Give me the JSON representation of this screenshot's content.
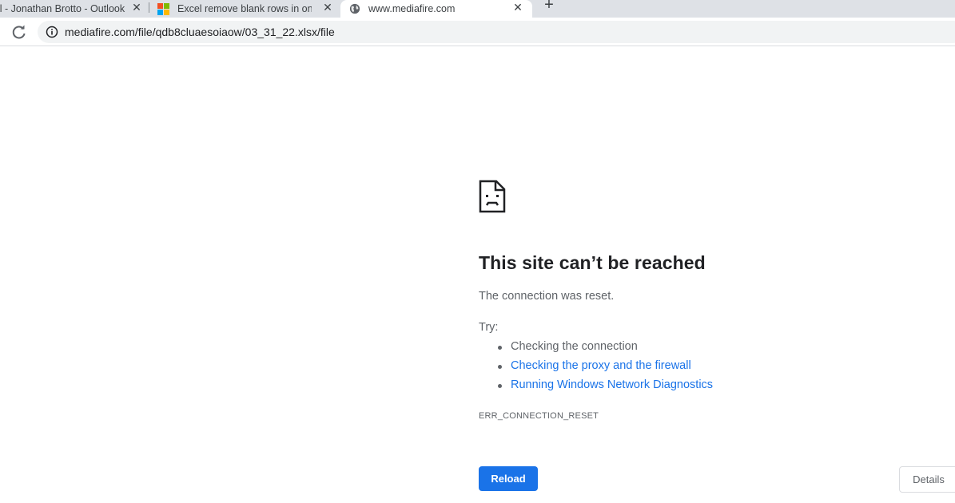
{
  "browser": {
    "tabs": [
      {
        "title": "il - Jonathan Brotto - Outlook",
        "close": "✕"
      },
      {
        "title": "Excel remove blank rows in one a",
        "close": "✕"
      },
      {
        "title": "www.mediafire.com",
        "close": "✕"
      }
    ],
    "new_tab": "+",
    "url": "mediafire.com/file/qdb8cluaesoiaow/03_31_22.xlsx/file"
  },
  "error_page": {
    "title": "This site can’t be reached",
    "message": "The connection was reset.",
    "try_label": "Try:",
    "suggestions": [
      "Checking the connection",
      "Checking the proxy and the firewall",
      "Running Windows Network Diagnostics"
    ],
    "error_code": "ERR_CONNECTION_RESET",
    "reload_label": "Reload",
    "details_label": "Details"
  },
  "colors": {
    "accent": "#1a73e8",
    "tabstrip": "#dee1e6",
    "text_secondary": "#5f6368"
  }
}
